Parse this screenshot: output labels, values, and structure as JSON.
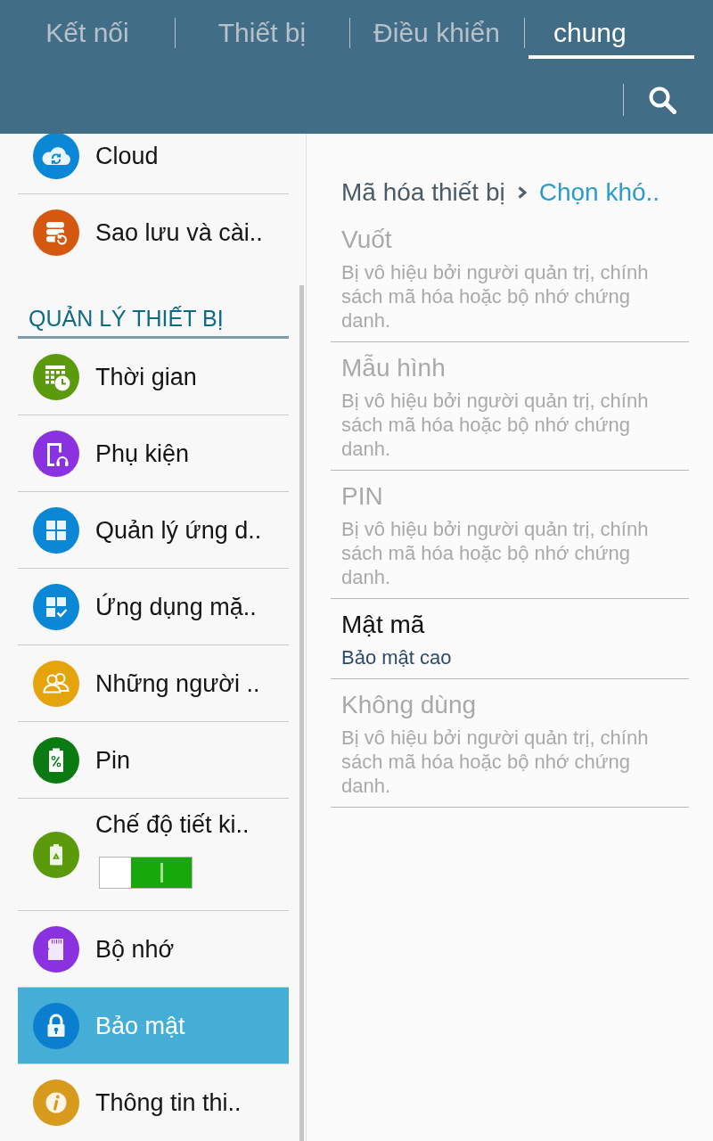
{
  "header": {
    "tabs": [
      {
        "label": "Kết nối",
        "selected": false
      },
      {
        "label": "Thiết bị",
        "selected": false
      },
      {
        "label": "Điều khiển",
        "selected": false
      },
      {
        "label": "chung",
        "selected": true
      }
    ]
  },
  "sidebar": {
    "groups": [
      {
        "items": [
          {
            "label": "Cloud",
            "kind": "plain",
            "selected": false,
            "color": "#0a87d5"
          },
          {
            "label": "Sao lưu và cài..",
            "kind": "plain",
            "selected": false,
            "color": "#d4580f"
          }
        ]
      },
      {
        "header": "QUẢN LÝ THIẾT BỊ",
        "items": [
          {
            "label": "Thời gian",
            "kind": "plain",
            "selected": false,
            "color": "#5b9a0c"
          },
          {
            "label": "Phụ kiện",
            "kind": "plain",
            "selected": false,
            "color": "#8a31e0"
          },
          {
            "label": "Quản lý ứng d..",
            "kind": "plain",
            "selected": false,
            "color": "#0a87d5"
          },
          {
            "label": "Ứng dụng mặ..",
            "kind": "plain",
            "selected": false,
            "color": "#0a87d5"
          },
          {
            "label": "Những người ..",
            "kind": "plain",
            "selected": false,
            "color": "#e6a40c"
          },
          {
            "label": "Pin",
            "kind": "plain",
            "selected": false,
            "color": "#0b7a12"
          },
          {
            "label": "Chế độ tiết ki..",
            "kind": "toggle",
            "on": true,
            "selected": false,
            "color": "#5b9a0c"
          },
          {
            "label": "Bộ nhớ",
            "kind": "plain",
            "selected": false,
            "color": "#8a31e0"
          },
          {
            "label": "Bảo mật",
            "kind": "plain",
            "selected": true,
            "color": "#0a7fcf"
          },
          {
            "label": "Thông tin thi..",
            "kind": "plain",
            "selected": false,
            "color": "#d79a1c"
          }
        ]
      }
    ]
  },
  "content": {
    "breadcrumb": {
      "parent": "Mã hóa thiết bị",
      "current": "Chọn khó.."
    },
    "options": [
      {
        "title": "Vuốt",
        "summary": "Bị vô hiệu bởi người quản trị, chính sách mã hóa hoặc bộ nhớ chứng danh.",
        "disabled": true
      },
      {
        "title": "Mẫu hình",
        "summary": "Bị vô hiệu bởi người quản trị, chính sách mã hóa hoặc bộ nhớ chứng danh.",
        "disabled": true
      },
      {
        "title": "PIN",
        "summary": "Bị vô hiệu bởi người quản trị, chính sách mã hóa hoặc bộ nhớ chứng danh.",
        "disabled": true
      },
      {
        "title": "Mật mã",
        "summary": "Bảo mật cao",
        "disabled": false
      },
      {
        "title": "Không dùng",
        "summary": "Bị vô hiệu bởi người quản trị, chính sách mã hóa hoặc bộ nhớ chứng danh.",
        "disabled": true
      }
    ]
  }
}
